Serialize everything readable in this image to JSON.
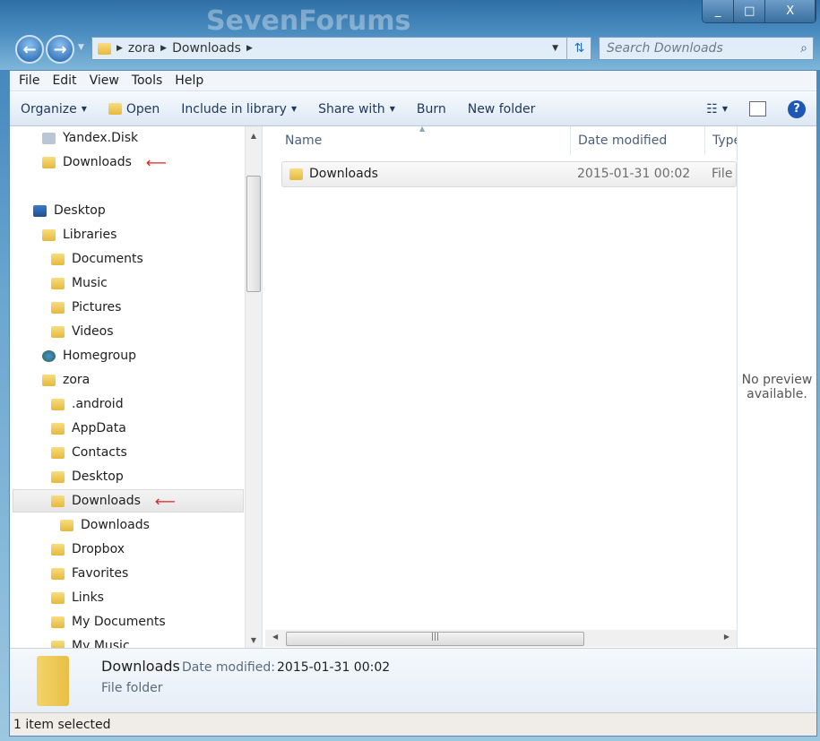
{
  "window": {
    "watermark": "SevenForums",
    "controls": {
      "minimize": "_",
      "maximize": "□",
      "close": "X"
    }
  },
  "address": {
    "segments": [
      "zora",
      "Downloads"
    ],
    "search_placeholder": "Search Downloads"
  },
  "menu": [
    "File",
    "Edit",
    "View",
    "Tools",
    "Help"
  ],
  "toolbar": {
    "organize": "Organize",
    "open": "Open",
    "include": "Include in library",
    "share": "Share with",
    "burn": "Burn",
    "new_folder": "New folder"
  },
  "nav": [
    {
      "label": "Yandex.Disk",
      "icon": "cloud-icon"
    },
    {
      "label": "Downloads",
      "icon": "downloads-folder-icon",
      "annotated": true
    },
    {
      "label": "Desktop",
      "icon": "desktop-icon"
    },
    {
      "label": "Libraries",
      "icon": "libraries-icon"
    },
    {
      "label": "Documents",
      "icon": "documents-icon"
    },
    {
      "label": "Music",
      "icon": "music-icon"
    },
    {
      "label": "Pictures",
      "icon": "pictures-icon"
    },
    {
      "label": "Videos",
      "icon": "videos-icon"
    },
    {
      "label": "Homegroup",
      "icon": "homegroup-icon"
    },
    {
      "label": "zora",
      "icon": "user-folder-icon"
    },
    {
      "label": ".android",
      "icon": "folder-icon"
    },
    {
      "label": "AppData",
      "icon": "folder-icon"
    },
    {
      "label": "Contacts",
      "icon": "contacts-folder-icon"
    },
    {
      "label": "Desktop",
      "icon": "desktop-folder-icon"
    },
    {
      "label": "Downloads",
      "icon": "downloads-folder-icon",
      "selected": true,
      "annotated": true
    },
    {
      "label": "Downloads",
      "icon": "folder-icon"
    },
    {
      "label": "Dropbox",
      "icon": "dropbox-folder-icon"
    },
    {
      "label": "Favorites",
      "icon": "favorites-folder-icon"
    },
    {
      "label": "Links",
      "icon": "links-folder-icon"
    },
    {
      "label": "My Documents",
      "icon": "documents-folder-icon"
    },
    {
      "label": "My Music",
      "icon": "music-folder-icon"
    }
  ],
  "columns": {
    "name": "Name",
    "date": "Date modified",
    "type": "Type"
  },
  "files": [
    {
      "name": "Downloads",
      "date": "2015-01-31 00:02",
      "type": "File"
    }
  ],
  "preview": {
    "text": "No preview available."
  },
  "details": {
    "name": "Downloads",
    "date_label": "Date modified:",
    "date": "2015-01-31 00:02",
    "type": "File folder"
  },
  "status": "1 item selected",
  "annotation_arrow": "⟵",
  "colors": {
    "accent": "#1e395b",
    "arrow": "#e02020"
  }
}
